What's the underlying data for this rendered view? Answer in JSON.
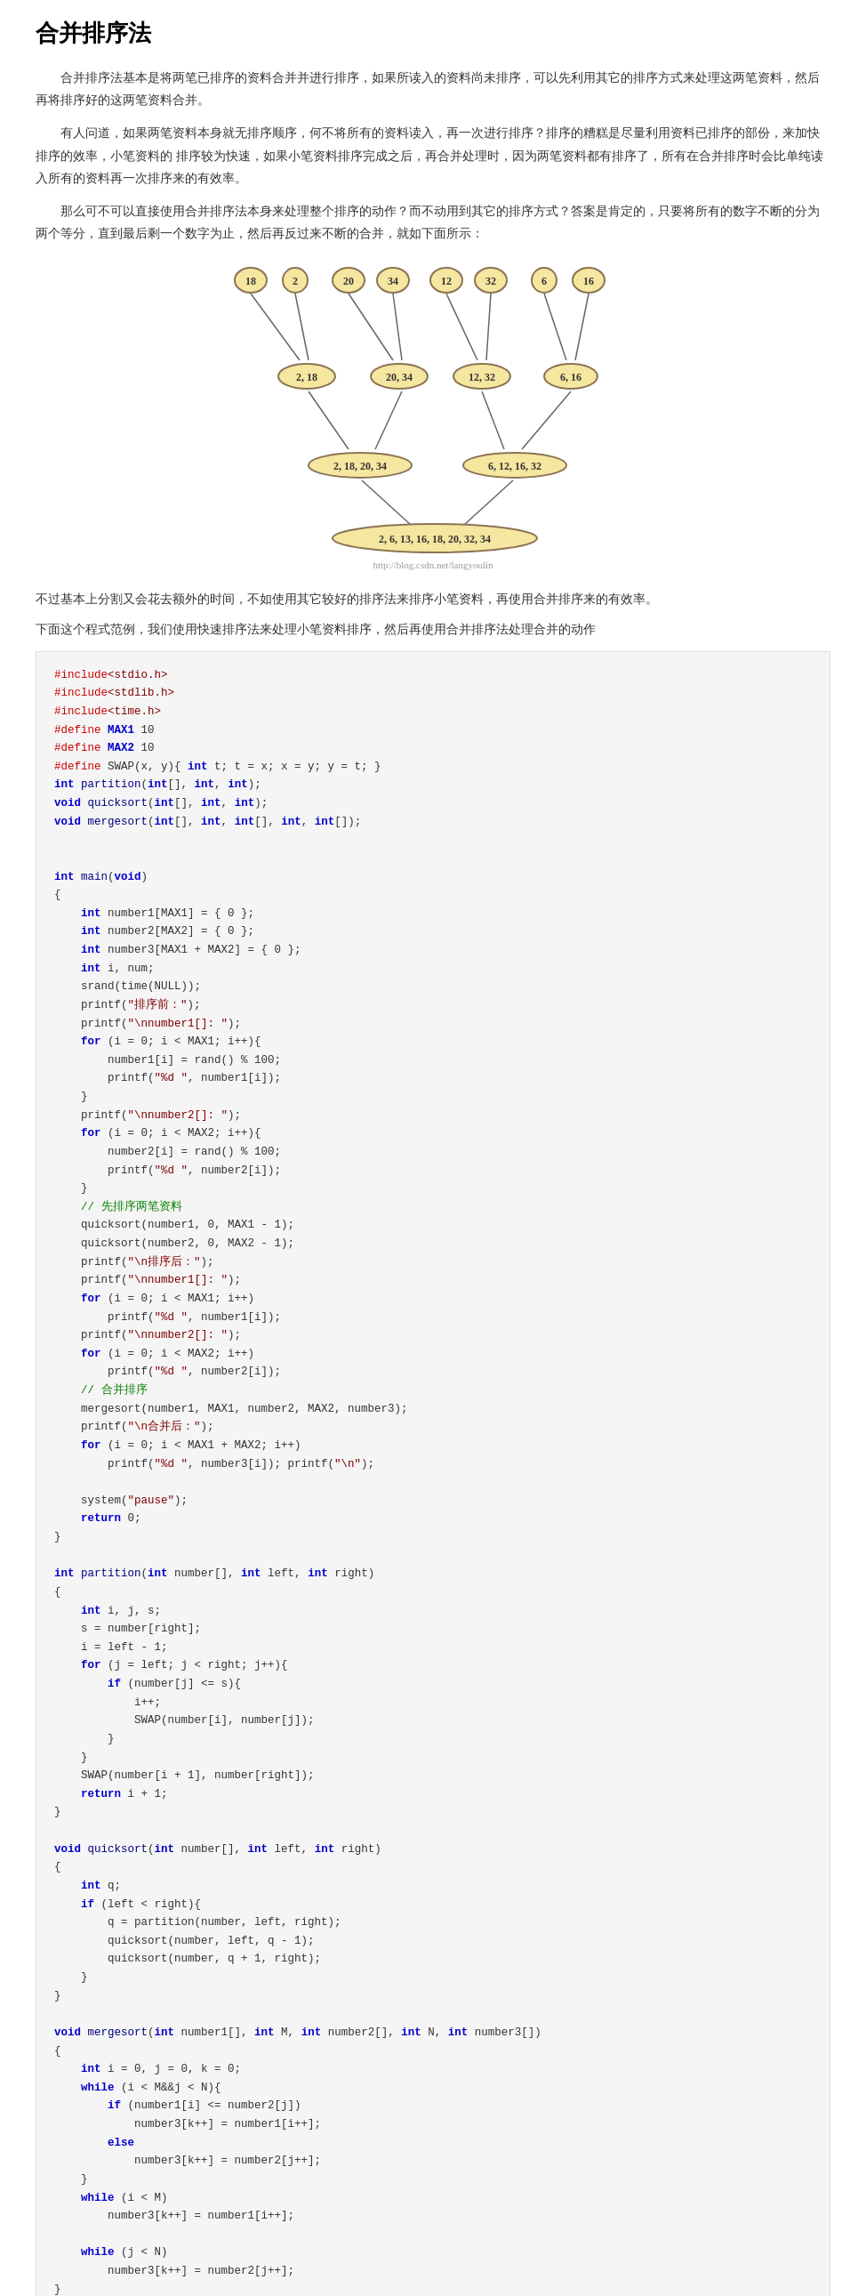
{
  "page": {
    "title": "合并排序法",
    "intro1": "合并排序法基本是将两笔已排序的资料合并并进行排序，如果所读入的资料尚未排序，可以先利用其它的排序方式来处理这两笔资料，然后再将排序好的这两笔资料合并。",
    "intro2": "有人问道，如果两笔资料本身就无排序顺序，何不将所有的资料读入，再一次进行排序？排序的糟糕是尽量利用资料已排序的部份，来加快排序的效率，小笔资料的 排序较为快速，如果小笔资料排序完成之后，再合并处理时，因为两笔资料都有排序了，所有在合并排序时会比单纯读入所有的资料再一次排序来的有效率。",
    "intro3": "那么可不可以直接使用合并排序法本身来处理整个排序的动作？而不动用到其它的排序方式？答案是肯定的，只要将所有的数字不断的分为两个等分，直到最后剩一个数字为止，然后再反过来不断的合并，就如下面所示：",
    "diagram_caption": "http://blog.csdn.net/langyoulin",
    "summary1": "不过基本上分割又会花去额外的时间，不如使用其它较好的排序法来排序小笔资料，再使用合并排序来的有效率。",
    "summary2": "下面这个程式范例，我们使用快速排序法来处理小笔资料排序，然后再使用合并排序法处理合并的动作",
    "code": "#include<stdio.h>\n#include<stdlib.h>\n#include<time.h>\n#define MAX1 10\n#define MAX2 10\n#define SWAP(x, y){ int t; t = x; x = y; y = t; }\nint partition(int[], int, int);\nvoid quicksort(int[], int, int);\nvoid mergesort(int[], int, int[], int, int[]);\n\n\nint main(void)\n{\n    int number1[MAX1] = { 0 };\n    int number2[MAX2] = { 0 };\n    int number3[MAX1 + MAX2] = { 0 };\n    int i, num;\n    srand(time(NULL));\n    printf(\"排序前：\");\n    printf(\"\\nnumber1[]: \");\n    for (i = 0; i < MAX1; i++){\n        number1[i] = rand() % 100;\n        printf(\"%d \", number1[i]);\n    }\n    printf(\"\\nnumber2[]: \");\n    for (i = 0; i < MAX2; i++){\n        number2[i] = rand() % 100;\n        printf(\"%d \", number2[i]);\n    }\n    // 先排序两笔资料\n    quicksort(number1, 0, MAX1 - 1);\n    quicksort(number2, 0, MAX2 - 1);\n    printf(\"\\n排序后：\");\n    printf(\"\\nnumber1[]: \");\n    for (i = 0; i < MAX1; i++)\n        printf(\"%d \", number1[i]);\n    printf(\"\\nnumber2[]: \");\n    for (i = 0; i < MAX2; i++)\n        printf(\"%d \", number2[i]);\n    // 合并排序\n    mergesort(number1, MAX1, number2, MAX2, number3);\n    printf(\"\\n合并后：\");\n    for (i = 0; i < MAX1 + MAX2; i++)\n        printf(\"%d \", number3[i]); printf(\"\\n\");\n\n    system(\"pause\");\n    return 0;\n}\n\nint partition(int number[], int left, int right)\n{\n    int i, j, s;\n    s = number[right];\n    i = left - 1;\n    for (j = left; j < right; j++){\n        if (number[j] <= s){\n            i++;\n            SWAP(number[i], number[j]);\n        }\n    }\n    SWAP(number[i + 1], number[right]);\n    return i + 1;\n}\n\nvoid quicksort(int number[], int left, int right)\n{\n    int q;\n    if (left < right){\n        q = partition(number, left, right);\n        quicksort(number, left, q - 1);\n        quicksort(number, q + 1, right);\n    }\n}\n\nvoid mergesort(int number1[], int M, int number2[], int N, int number3[])\n{\n    int i = 0, j = 0, k = 0;\n    while (i < M&&j < N){\n        if (number1[i] <= number2[j])\n            number3[k++] = number1[i++];\n        else\n            number3[k++] = number2[j++];\n    }\n    while (i < M)\n        number3[k++] = number1[i++];\n\n    while (j < N)\n        number3[k++] = number2[j++];\n}"
  }
}
